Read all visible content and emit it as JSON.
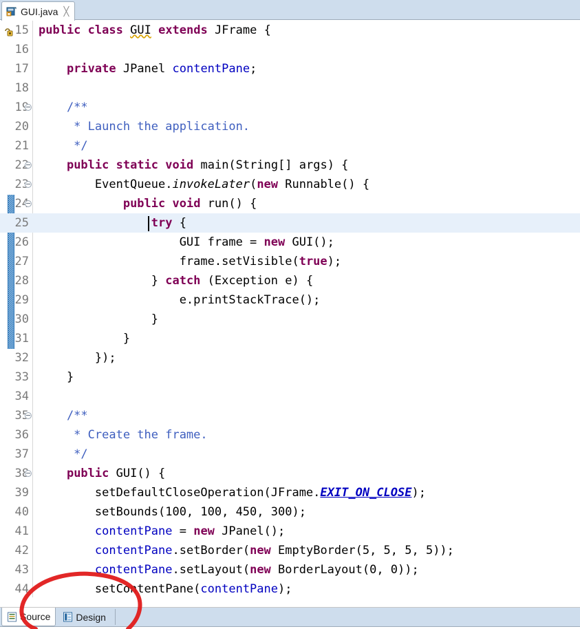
{
  "window": {
    "app": "Eclipse IDE",
    "editor_tab": {
      "label": "GUI.java",
      "close_glyph": "╳",
      "icon": "java-class-icon"
    }
  },
  "editor": {
    "caret_line": 25,
    "current_line_highlight_color": "#e7f0fa",
    "change_bar": {
      "from_line": 24,
      "to_line": 31,
      "color": "#2e75b6"
    },
    "lines": [
      {
        "n": "15",
        "fold": false,
        "marker": "override-warning-icon",
        "tokens": [
          {
            "t": "public",
            "c": "kw"
          },
          {
            "t": " ",
            "c": ""
          },
          {
            "t": "class",
            "c": "kw"
          },
          {
            "t": " ",
            "c": ""
          },
          {
            "t": "GUI",
            "c": "warn"
          },
          {
            "t": " ",
            "c": ""
          },
          {
            "t": "extends",
            "c": "kw"
          },
          {
            "t": " JFrame {",
            "c": ""
          }
        ]
      },
      {
        "n": "16",
        "fold": false,
        "tokens": []
      },
      {
        "n": "17",
        "fold": false,
        "tokens": [
          {
            "t": "    ",
            "c": ""
          },
          {
            "t": "private",
            "c": "kw"
          },
          {
            "t": " JPanel ",
            "c": ""
          },
          {
            "t": "contentPane",
            "c": "fld"
          },
          {
            "t": ";",
            "c": ""
          }
        ]
      },
      {
        "n": "18",
        "fold": false,
        "tokens": []
      },
      {
        "n": "19",
        "fold": true,
        "tokens": [
          {
            "t": "    /**",
            "c": "cmt"
          }
        ]
      },
      {
        "n": "20",
        "fold": false,
        "tokens": [
          {
            "t": "     * Launch the application.",
            "c": "cmt"
          }
        ]
      },
      {
        "n": "21",
        "fold": false,
        "tokens": [
          {
            "t": "     */",
            "c": "cmt"
          }
        ]
      },
      {
        "n": "22",
        "fold": true,
        "tokens": [
          {
            "t": "    ",
            "c": ""
          },
          {
            "t": "public",
            "c": "kw"
          },
          {
            "t": " ",
            "c": ""
          },
          {
            "t": "static",
            "c": "kw"
          },
          {
            "t": " ",
            "c": ""
          },
          {
            "t": "void",
            "c": "kw"
          },
          {
            "t": " main(String[] args) {",
            "c": ""
          }
        ]
      },
      {
        "n": "23",
        "fold": true,
        "tokens": [
          {
            "t": "        EventQueue.",
            "c": ""
          },
          {
            "t": "invokeLater",
            "c": "mth"
          },
          {
            "t": "(",
            "c": ""
          },
          {
            "t": "new",
            "c": "kw"
          },
          {
            "t": " Runnable() {",
            "c": ""
          }
        ]
      },
      {
        "n": "24",
        "fold": true,
        "tokens": [
          {
            "t": "            ",
            "c": ""
          },
          {
            "t": "public",
            "c": "kw"
          },
          {
            "t": " ",
            "c": ""
          },
          {
            "t": "void",
            "c": "kw"
          },
          {
            "t": " run() {",
            "c": ""
          }
        ]
      },
      {
        "n": "25",
        "fold": false,
        "current": true,
        "caret": true,
        "tokens": [
          {
            "t": "                ",
            "c": ""
          },
          {
            "t": "try",
            "c": "kw"
          },
          {
            "t": " {",
            "c": ""
          }
        ]
      },
      {
        "n": "26",
        "fold": false,
        "tokens": [
          {
            "t": "                    GUI frame = ",
            "c": ""
          },
          {
            "t": "new",
            "c": "kw"
          },
          {
            "t": " GUI();",
            "c": ""
          }
        ]
      },
      {
        "n": "27",
        "fold": false,
        "tokens": [
          {
            "t": "                    frame.setVisible(",
            "c": ""
          },
          {
            "t": "true",
            "c": "kw"
          },
          {
            "t": ");",
            "c": ""
          }
        ]
      },
      {
        "n": "28",
        "fold": false,
        "tokens": [
          {
            "t": "                } ",
            "c": ""
          },
          {
            "t": "catch",
            "c": "kw"
          },
          {
            "t": " (Exception e) {",
            "c": ""
          }
        ]
      },
      {
        "n": "29",
        "fold": false,
        "tokens": [
          {
            "t": "                    e.printStackTrace();",
            "c": ""
          }
        ]
      },
      {
        "n": "30",
        "fold": false,
        "tokens": [
          {
            "t": "                }",
            "c": ""
          }
        ]
      },
      {
        "n": "31",
        "fold": false,
        "tokens": [
          {
            "t": "            }",
            "c": ""
          }
        ]
      },
      {
        "n": "32",
        "fold": false,
        "tokens": [
          {
            "t": "        });",
            "c": ""
          }
        ]
      },
      {
        "n": "33",
        "fold": false,
        "tokens": [
          {
            "t": "    }",
            "c": ""
          }
        ]
      },
      {
        "n": "34",
        "fold": false,
        "tokens": []
      },
      {
        "n": "35",
        "fold": true,
        "tokens": [
          {
            "t": "    /**",
            "c": "cmt"
          }
        ]
      },
      {
        "n": "36",
        "fold": false,
        "tokens": [
          {
            "t": "     * Create the frame.",
            "c": "cmt"
          }
        ]
      },
      {
        "n": "37",
        "fold": false,
        "tokens": [
          {
            "t": "     */",
            "c": "cmt"
          }
        ]
      },
      {
        "n": "38",
        "fold": true,
        "tokens": [
          {
            "t": "    ",
            "c": ""
          },
          {
            "t": "public",
            "c": "kw"
          },
          {
            "t": " GUI() {",
            "c": ""
          }
        ]
      },
      {
        "n": "39",
        "fold": false,
        "tokens": [
          {
            "t": "        setDefaultCloseOperation(JFrame.",
            "c": ""
          },
          {
            "t": "EXIT_ON_CLOSE",
            "c": "sfld"
          },
          {
            "t": ");",
            "c": ""
          }
        ]
      },
      {
        "n": "40",
        "fold": false,
        "tokens": [
          {
            "t": "        setBounds(100, 100, 450, 300);",
            "c": ""
          }
        ]
      },
      {
        "n": "41",
        "fold": false,
        "tokens": [
          {
            "t": "        ",
            "c": ""
          },
          {
            "t": "contentPane",
            "c": "fld"
          },
          {
            "t": " = ",
            "c": ""
          },
          {
            "t": "new",
            "c": "kw"
          },
          {
            "t": " JPanel();",
            "c": ""
          }
        ]
      },
      {
        "n": "42",
        "fold": false,
        "tokens": [
          {
            "t": "        ",
            "c": ""
          },
          {
            "t": "contentPane",
            "c": "fld"
          },
          {
            "t": ".setBorder(",
            "c": ""
          },
          {
            "t": "new",
            "c": "kw"
          },
          {
            "t": " EmptyBorder(5, 5, 5, 5));",
            "c": ""
          }
        ]
      },
      {
        "n": "43",
        "fold": false,
        "tokens": [
          {
            "t": "        ",
            "c": ""
          },
          {
            "t": "contentPane",
            "c": "fld"
          },
          {
            "t": ".setLayout(",
            "c": ""
          },
          {
            "t": "new",
            "c": "kw"
          },
          {
            "t": " BorderLayout(0, 0));",
            "c": ""
          }
        ]
      },
      {
        "n": "44",
        "fold": false,
        "tokens": [
          {
            "t": "        setContentPane(",
            "c": ""
          },
          {
            "t": "contentPane",
            "c": "fld"
          },
          {
            "t": ");",
            "c": ""
          }
        ]
      }
    ]
  },
  "bottom_tabs": [
    {
      "label": "Source",
      "icon": "source-view-icon",
      "active": true
    },
    {
      "label": "Design",
      "icon": "design-view-icon",
      "active": false
    }
  ],
  "annotation": {
    "shape": "hand-drawn-ellipse",
    "color": "#e01b1b"
  },
  "colors": {
    "tabstrip_bg": "#cedded",
    "keyword": "#7f0055",
    "comment": "#3f5fbf",
    "field": "#0000c0",
    "editor_bg": "#ffffff"
  }
}
